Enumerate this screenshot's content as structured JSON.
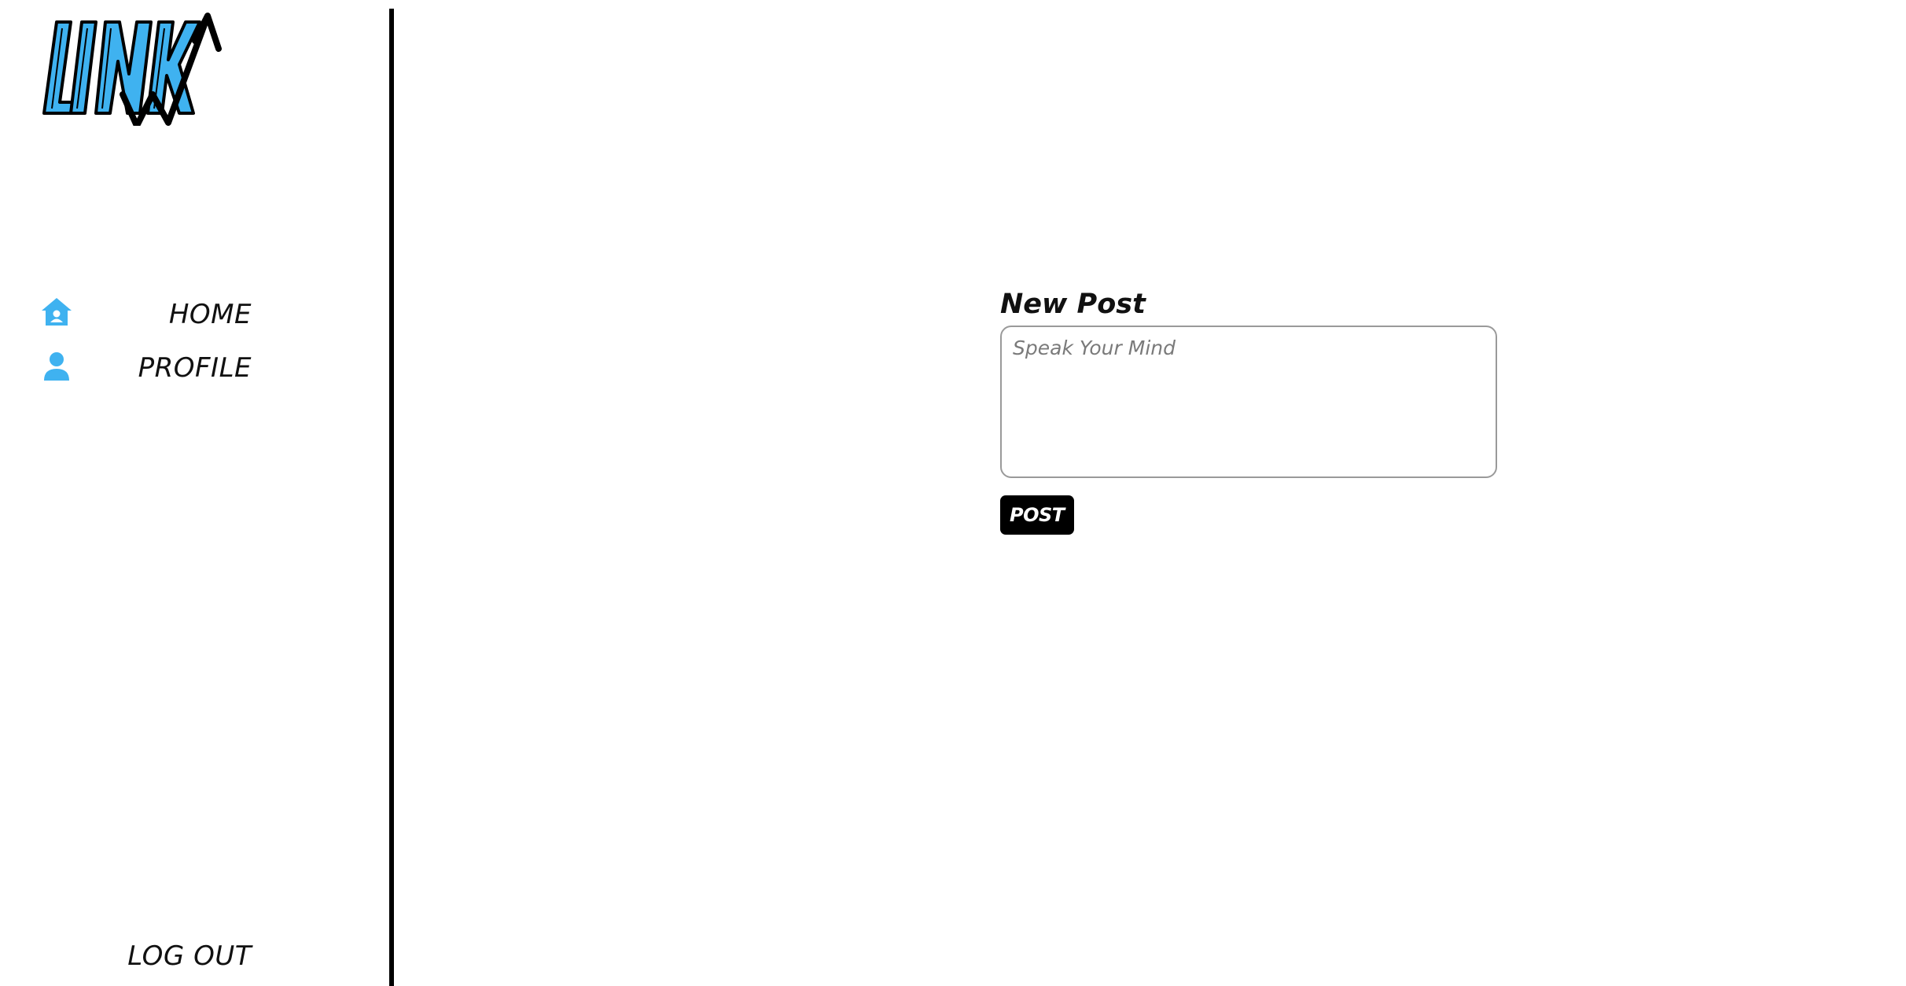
{
  "app": {
    "logo_text": "LINK",
    "brand_color": "#3fb2f0"
  },
  "sidebar": {
    "items": [
      {
        "label": "HOME",
        "icon": "house-icon"
      },
      {
        "label": "PROFILE",
        "icon": "user-icon"
      }
    ],
    "logout_label": "LOG OUT"
  },
  "composer": {
    "title": "New Post",
    "placeholder": "Speak Your Mind",
    "value": "",
    "post_label": "POST"
  }
}
